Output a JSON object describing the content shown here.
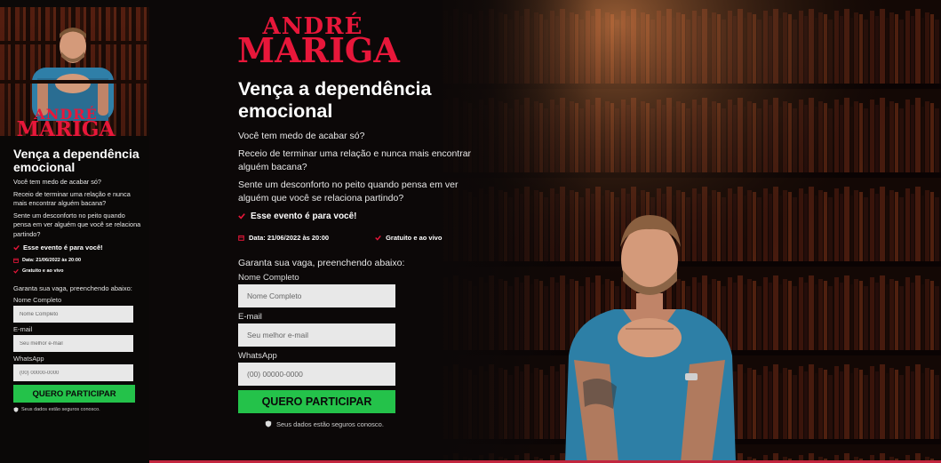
{
  "brand": {
    "line1": "ANDRÉ",
    "line2": "MARIGA",
    "color": "#e8173a"
  },
  "headline": "Vença a dependência emocional",
  "paragraphs": [
    "Você tem medo de acabar só?",
    "Receio de terminar uma relação e nunca mais encontrar alguém bacana?",
    "Sente um desconforto no peito quando pensa em ver alguém que você se relaciona partindo?"
  ],
  "highlight": "Esse evento é para você!",
  "event": {
    "date": "Data: 21/06/2022 às 20:00",
    "type": "Gratuito e ao vivo"
  },
  "form": {
    "intro": "Garanta sua vaga, preenchendo abaixo:",
    "name_label": "Nome Completo",
    "name_placeholder": "Nome Completo",
    "email_label": "E-mail",
    "email_placeholder": "Seu melhor e-mail",
    "phone_label": "WhatsApp",
    "phone_placeholder": "(00) 00000-0000",
    "submit_label": "QUERO PARTICIPAR",
    "secure_text": "Seus dados estão seguros conosco."
  },
  "colors": {
    "accent": "#e8173a",
    "button": "#24c24a",
    "background": "#0c0808"
  },
  "icons": {
    "check": "check-icon",
    "calendar": "calendar-icon",
    "shield": "shield-icon"
  }
}
